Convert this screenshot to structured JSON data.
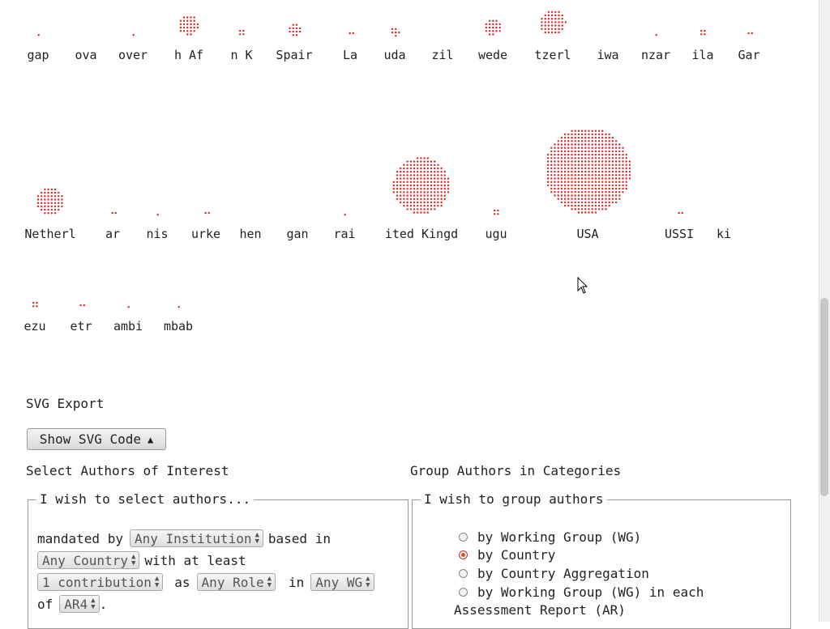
{
  "viz": {
    "dot_color": "#e02020",
    "rows": [
      {
        "items": [
          {
            "label": "gap",
            "count": 1
          },
          {
            "label": "ova",
            "count": 0
          },
          {
            "label": "over",
            "count": 1
          },
          {
            "label": "h Af",
            "count": 28
          },
          {
            "label": "n K",
            "count": 4
          },
          {
            "label": "Spair",
            "count": 12
          },
          {
            "label": "La",
            "count": 2
          },
          {
            "label": "uda",
            "count": 6
          },
          {
            "label": "zil",
            "count": 0
          },
          {
            "label": "wede",
            "count": 20
          },
          {
            "label": "tzerl",
            "count": 44
          },
          {
            "label": "iwa",
            "count": 0
          },
          {
            "label": "nzar",
            "count": 1
          },
          {
            "label": "ila",
            "count": 4
          },
          {
            "label": "Gar",
            "count": 2
          }
        ]
      },
      {
        "items": [
          {
            "label": "Netherl",
            "count": 52
          },
          {
            "label": "ar",
            "count": 2
          },
          {
            "label": "nis",
            "count": 1
          },
          {
            "label": "urke",
            "count": 2
          },
          {
            "label": "hen",
            "count": 0
          },
          {
            "label": "gan",
            "count": 0
          },
          {
            "label": "rai",
            "count": 1
          },
          {
            "label": "ited Kingd",
            "count": 220
          },
          {
            "label": "ugu",
            "count": 4
          },
          {
            "label": "USA",
            "count": 500
          },
          {
            "label": "USSI",
            "count": 2
          },
          {
            "label": "ki",
            "count": 0
          }
        ]
      },
      {
        "items": [
          {
            "label": "ezu",
            "count": 4
          },
          {
            "label": "etr",
            "count": 2
          },
          {
            "label": "ambi",
            "count": 1
          },
          {
            "label": "mbab",
            "count": 1
          }
        ]
      }
    ]
  },
  "svg_export": {
    "title": "SVG Export",
    "button_label": "Show SVG Code",
    "button_arrow": "▲"
  },
  "select_authors": {
    "title": "Select Authors of Interest",
    "legend": "I wish to select authors...",
    "mandated_by": "mandated by",
    "institution_value": "Any Institution",
    "based_in": "based in",
    "country_value": "Any Country",
    "with_at_least": "with at least",
    "contribution_value": "1 contribution",
    "as": "as",
    "role_value": "Any Role",
    "in": "in",
    "wg_value": "Any WG",
    "of": "of",
    "ar_value": "AR4",
    "period": "."
  },
  "group_authors": {
    "title": "Group Authors in Categories",
    "legend": "I wish to group authors",
    "options": [
      {
        "label": "by Working Group (WG)",
        "checked": false
      },
      {
        "label": "by Country",
        "checked": true
      },
      {
        "label": "by Country Aggregation",
        "checked": false
      },
      {
        "label": "by Working Group (WG) in each",
        "checked": false
      }
    ],
    "option4_continuation": "Assessment Report (AR)"
  }
}
